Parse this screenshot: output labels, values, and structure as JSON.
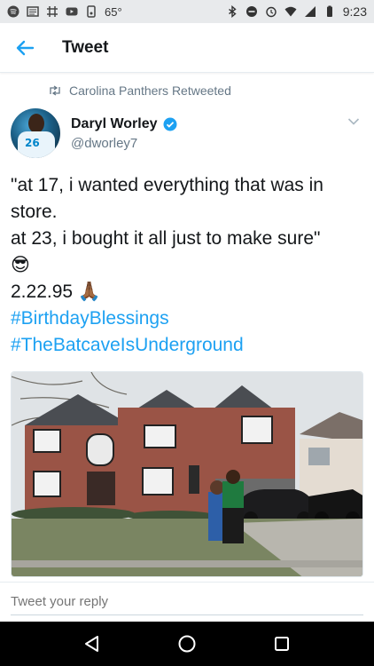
{
  "status_bar": {
    "temperature": "65°",
    "time": "9:23"
  },
  "appbar": {
    "title": "Tweet"
  },
  "retweet": {
    "label": "Carolina Panthers Retweeted"
  },
  "author": {
    "name": "Daryl Worley",
    "handle": "@dworley7",
    "avatar_number": "26"
  },
  "tweet": {
    "line1": "\"at 17, i wanted everything that was in",
    "line2": "store.",
    "line3": "at 23, i bought it all just to make sure\"",
    "line4": "😎",
    "line5": "2.22.95 🙏🏾",
    "hashtag1": "#BirthdayBlessings",
    "hashtag2": "#TheBatcaveIsUnderground"
  },
  "reply": {
    "placeholder": "Tweet your reply"
  },
  "colors": {
    "accent": "#1da1f2",
    "text": "#14171a",
    "muted": "#657786"
  }
}
